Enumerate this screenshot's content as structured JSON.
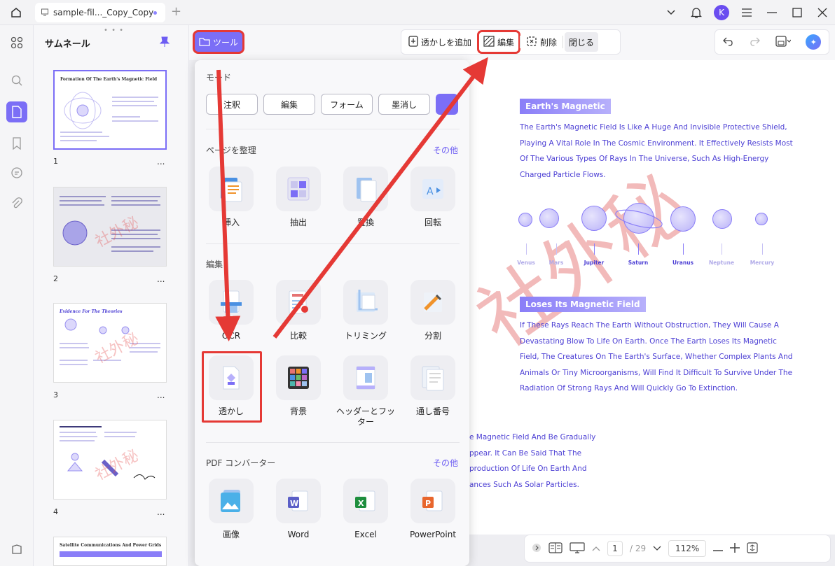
{
  "titlebar": {
    "tab_title": "sample-fil..._Copy_Copy",
    "new_tab": "+",
    "avatar_letter": "K"
  },
  "thumbnails": {
    "title": "サムネール",
    "pages": [
      {
        "num": "1",
        "title": "Formation Of The Earth's Magnetic Field",
        "selected": true
      },
      {
        "num": "2",
        "title": "",
        "selected": false
      },
      {
        "num": "3",
        "title": "Evidence For The Theories",
        "selected": false
      },
      {
        "num": "4",
        "title": "",
        "selected": false
      },
      {
        "num": "",
        "title": "Satellite Communications And Power Grids",
        "selected": false
      }
    ],
    "more": "..."
  },
  "toolbar": {
    "tool_label": "ツール",
    "add_watermark": "透かしを追加",
    "edit": "編集",
    "delete": "削除",
    "close": "閉じる"
  },
  "popup": {
    "mode_title": "モード",
    "modes": [
      "注釈",
      "編集",
      "フォーム",
      "墨消し"
    ],
    "organize_title": "ページを整理",
    "organize_more": "その他",
    "organize_tools": [
      "挿入",
      "抽出",
      "置換",
      "回転"
    ],
    "edit_title": "編集",
    "edit_tools": [
      "OCR",
      "比較",
      "トリミング",
      "分割",
      "透かし",
      "背景",
      "ヘッダーとフッター",
      "通し番号"
    ],
    "converter_title": "PDF コンバーター",
    "converter_more": "その他",
    "converter_tools": [
      "画像",
      "Word",
      "Excel",
      "PowerPoint"
    ]
  },
  "document": {
    "heading1": "Earth's Magnetic",
    "para1": [
      "The Earth's Magnetic Field Is Like A Huge And Invisible Protective Shield,",
      "Playing A Vital Role In The Cosmic Environment. It Effectively Resists Most",
      "Of The Various Types Of Rays In The Universe, Such As High-Energy",
      "Charged Particle Flows."
    ],
    "planets": [
      "Venus",
      "Mars",
      "Jupiter",
      "Saturn",
      "Uranus",
      "Neptune",
      "Mercury"
    ],
    "heading2": "Loses Its Magnetic Field",
    "para2": [
      "If These Rays Reach The Earth Without Obstruction, They Will Cause A",
      "Devastating Blow To Life On Earth. Once The Earth Loses Its Magnetic",
      "Field, The Creatures On The Earth's Surface, Whether Complex Plants And",
      "Animals Or Tiny Microorganisms, Will Find It Difficult To Survive Under The",
      "Radiation Of Strong Rays And Will Quickly Go To Extinction."
    ],
    "para3": [
      "e Magnetic Field And Be Gradually",
      "ppear. It Can Be Said That The",
      "production Of Life On Earth And",
      "ances Such As Solar Particles."
    ],
    "watermark": "社外秘"
  },
  "navbar": {
    "current_page": "1",
    "total_pages": "/ 29",
    "zoom": "112%"
  },
  "colors": {
    "accent": "#7b6ef6",
    "highlight_red": "#e53935",
    "doc_text": "#4c3fd4"
  }
}
